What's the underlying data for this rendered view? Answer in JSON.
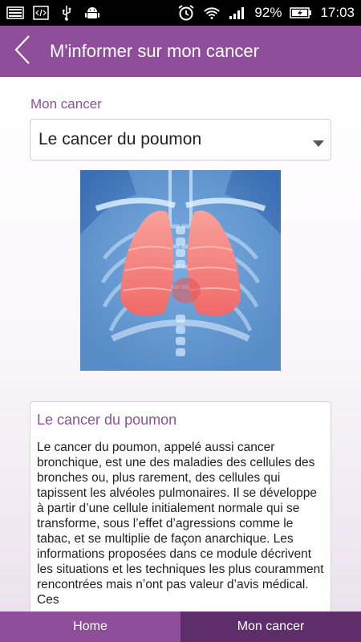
{
  "status_bar": {
    "battery_percent": "92%",
    "time": "17:03",
    "icons": [
      "gallery-icon",
      "code-icon",
      "usb-icon",
      "android-icon",
      "alarm-icon",
      "wifi-icon",
      "signal-icon",
      "battery-icon"
    ]
  },
  "app_bar": {
    "title": "M'informer sur mon cancer",
    "back_icon": "chevron-left-icon",
    "color": "#8e4e9a"
  },
  "form": {
    "label": "Mon cancer",
    "selected": "Le cancer du poumon",
    "caret_icon": "caret-down-icon"
  },
  "hero_image": {
    "subject": "lungs-illustration"
  },
  "info_card": {
    "title": "Le cancer du poumon",
    "body": "Le cancer du poumon, appelé aussi cancer bronchique, est une des maladies des cellules des bronches ou, plus rarement, des cellules qui tapissent les alvéoles pulmonaires. Il se développe à partir d’une cellule initialement normale qui se transforme, sous l’effet d’agressions comme le tabac, et se multiplie de façon anarchique. Les informations proposées dans ce module décrivent les situations et les techniques les plus couramment rencontrées mais n’ont pas valeur d’avis médical. Ces"
  },
  "tabs": [
    {
      "label": "Home",
      "active": false
    },
    {
      "label": "Mon cancer",
      "active": true
    }
  ],
  "colors": {
    "accent": "#8e4e9a",
    "accent_dark": "#5e2e6a",
    "image_bg": "#3b6fb3",
    "lung": "#f47b7b"
  }
}
